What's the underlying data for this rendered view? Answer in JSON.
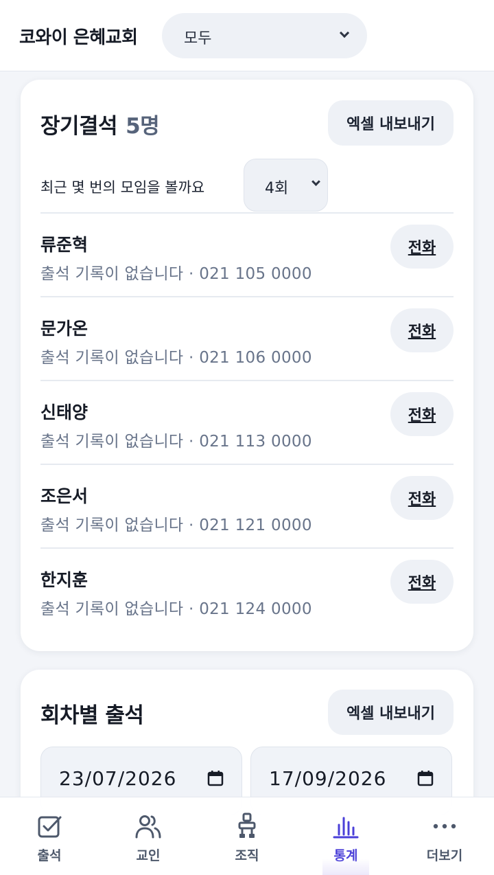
{
  "header": {
    "church_name": "코와이 은혜교회",
    "filter": {
      "selected": "모두"
    }
  },
  "long_absence": {
    "title": "장기결석",
    "count": "5명",
    "export_label": "엑셀 내보내기",
    "recent_label": "최근 몇 번의 모임을 볼까요",
    "rounds_selected": "4회",
    "call_label": "전화",
    "members": [
      {
        "name": "류준혁",
        "status": "출석 기록이 없습니다 · 021 105 0000"
      },
      {
        "name": "문가온",
        "status": "출석 기록이 없습니다 · 021 106 0000"
      },
      {
        "name": "신태양",
        "status": "출석 기록이 없습니다 · 021 113 0000"
      },
      {
        "name": "조은서",
        "status": "출석 기록이 없습니다 · 021 121 0000"
      },
      {
        "name": "한지훈",
        "status": "출석 기록이 없습니다 · 021 124 0000"
      }
    ]
  },
  "session_attendance": {
    "title": "회차별 출석",
    "export_label": "엑셀 내보내기",
    "start_date": "23/07/2026",
    "end_date": "17/09/2026"
  },
  "nav": {
    "items": [
      {
        "label": "출석",
        "icon": "check-square-icon"
      },
      {
        "label": "교인",
        "icon": "people-icon"
      },
      {
        "label": "조직",
        "icon": "org-chart-icon"
      },
      {
        "label": "통계",
        "icon": "bar-chart-icon"
      },
      {
        "label": "더보기",
        "icon": "more-dots-icon"
      }
    ],
    "active": "통계",
    "active_color": "#4a3fd8",
    "inactive_color": "#4d586b"
  }
}
